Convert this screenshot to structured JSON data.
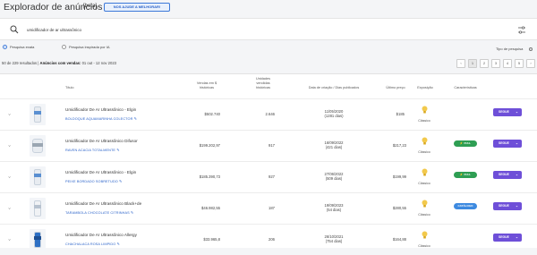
{
  "header": {
    "title": "Explorador de anúncios",
    "beta": "[beta]",
    "help_button": "NOS AJUDE A MELHORAR!"
  },
  "search": {
    "value": "umidificador de ar ultrassônico",
    "placeholder": ""
  },
  "search_type": {
    "option_exact": "Pesquisa exata",
    "option_ai": "Pesquisa inspirada por IA",
    "selected": "Pesquisa exata",
    "tipo_label": "Tipo de pesquisa"
  },
  "results": {
    "summary_prefix": "50 de 229 resultados |",
    "summary_bold": "Anúncios com vendas:",
    "summary_suffix": "01 out - 12 nov 2023"
  },
  "pagination": {
    "prev": "‹",
    "pages": [
      "1",
      "2",
      "3",
      "4",
      "5"
    ],
    "next": "›",
    "active": "1"
  },
  "table": {
    "headers": {
      "title": "Título",
      "revenue": "Vendas em $ históricas",
      "units": "Unidades vendidas históricas",
      "date": "Data de criação / Dias publicados",
      "price": "Último preço",
      "exposure": "Exposição",
      "features": "Características"
    },
    "rows": [
      {
        "title": "Umidificador De Ar Ultrassônico - Elgin",
        "variant": "BOLDOQUE AQUAMARINHA COLECTOR",
        "revenue": "$502.740",
        "units": "2.646",
        "date": "11/05/2020",
        "days": "(1281 dias)",
        "price": "$185",
        "exposure": "Clássico",
        "badge": "",
        "action": "SEGUE"
      },
      {
        "title": "Umidificador De Ar Ultrassônico Difusor",
        "variant": "RAVEN ACACIA TOTALMENTE",
        "revenue": "$199.202,97",
        "units": "917",
        "date": "16/09/2022",
        "days": "(421 dias)",
        "price": "$217,23",
        "exposure": "Clássico",
        "badge": "FULL",
        "action": "SEGUE"
      },
      {
        "title": "Umidificador De Ar Ultrassônico - Elgin",
        "variant": "PEIXE BORDADO SOBRETUDO",
        "revenue": "$185.390,73",
        "units": "927",
        "date": "27/06/2022",
        "days": "(509 dias)",
        "price": "$199,99",
        "exposure": "Clássico",
        "badge": "FULL",
        "action": "SEGUE"
      },
      {
        "title": "Umidificador De Ar Ultrassônico Black+de",
        "variant": "TARAMBOLA CHOCOLATE CITRINHAS",
        "revenue": "$46.982,55",
        "units": "187",
        "date": "19/09/2023",
        "days": "(54 dias)",
        "price": "$280,55",
        "exposure": "Clássico",
        "badge": "CATÁLOGO",
        "action": "SEGUE"
      },
      {
        "title": "Umidificador De Ar Ultrassônico Allergy",
        "variant": "CHACHALACA ROSA LIMPIDO",
        "revenue": "$33.965,8",
        "units": "206",
        "date": "26/10/2021",
        "days": "(754 dias)",
        "price": "$164,88",
        "exposure": "Clássico",
        "badge": "",
        "action": "SEGUE"
      }
    ]
  },
  "colors": {
    "link": "#2a62c9",
    "action": "#6e4fd8",
    "full_badge": "#2e9e53",
    "catalog_badge": "#3d8ae0",
    "bulb": "#f2c94c"
  },
  "icons": {
    "search": "search-icon",
    "filter": "sliders-icon",
    "expand": "chevron-right-icon",
    "exposure": "lightbulb-icon",
    "edit": "pencil-icon"
  }
}
